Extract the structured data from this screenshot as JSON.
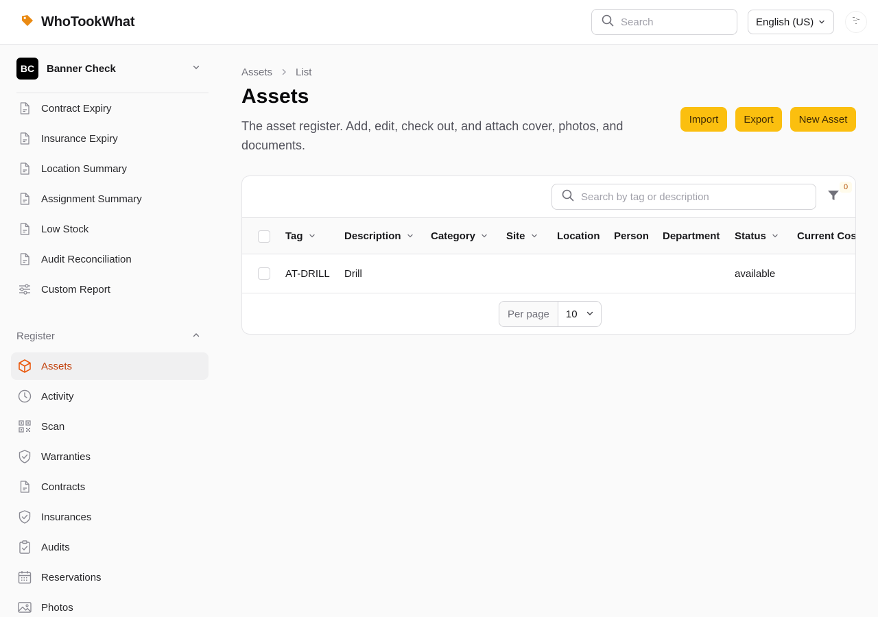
{
  "app": {
    "name": "WhoTookWhat",
    "accent": "#ea8a12"
  },
  "topbar": {
    "search_placeholder": "Search",
    "language": "English (US)"
  },
  "sidebar": {
    "org": {
      "initials": "BC",
      "name": "Banner Check"
    },
    "reports": [
      {
        "label": "Contract Expiry",
        "icon": "document-icon"
      },
      {
        "label": "Insurance Expiry",
        "icon": "document-icon"
      },
      {
        "label": "Location Summary",
        "icon": "document-icon"
      },
      {
        "label": "Assignment Summary",
        "icon": "document-icon"
      },
      {
        "label": "Low Stock",
        "icon": "document-icon"
      },
      {
        "label": "Audit Reconciliation",
        "icon": "document-icon"
      },
      {
        "label": "Custom Report",
        "icon": "sliders-icon"
      }
    ],
    "register_label": "Register",
    "register": [
      {
        "label": "Assets",
        "icon": "cube-icon",
        "active": true
      },
      {
        "label": "Activity",
        "icon": "clock-icon"
      },
      {
        "label": "Scan",
        "icon": "qr-icon"
      },
      {
        "label": "Warranties",
        "icon": "shield-icon"
      },
      {
        "label": "Contracts",
        "icon": "document-icon"
      },
      {
        "label": "Insurances",
        "icon": "shield-icon"
      },
      {
        "label": "Audits",
        "icon": "clipboard-icon"
      },
      {
        "label": "Reservations",
        "icon": "calendar-icon"
      },
      {
        "label": "Photos",
        "icon": "image-icon"
      }
    ]
  },
  "main": {
    "breadcrumb": [
      "Assets",
      "List"
    ],
    "title": "Assets",
    "description": "The asset register. Add, edit, check out, and attach cover, photos, and documents.",
    "actions": {
      "import": "Import",
      "export": "Export",
      "new": "New Asset"
    },
    "table": {
      "search_placeholder": "Search by tag or description",
      "filter_count": "0",
      "columns": [
        {
          "label": "Tag",
          "sortable": true
        },
        {
          "label": "Description",
          "sortable": true
        },
        {
          "label": "Category",
          "sortable": true
        },
        {
          "label": "Site",
          "sortable": true
        },
        {
          "label": "Location",
          "sortable": false
        },
        {
          "label": "Person",
          "sortable": false
        },
        {
          "label": "Department",
          "sortable": false
        },
        {
          "label": "Status",
          "sortable": true
        },
        {
          "label": "Current Cost",
          "sortable": false
        }
      ],
      "rows": [
        {
          "tag": "AT-DRILL",
          "description": "Drill",
          "category": "",
          "site": "",
          "location": "",
          "person": "",
          "department": "",
          "status": "available",
          "current_cost": ""
        }
      ],
      "per_page_label": "Per page",
      "per_page_value": "10"
    }
  },
  "colors": {
    "button": "#fbbf0f",
    "active_text": "#c2410c"
  }
}
